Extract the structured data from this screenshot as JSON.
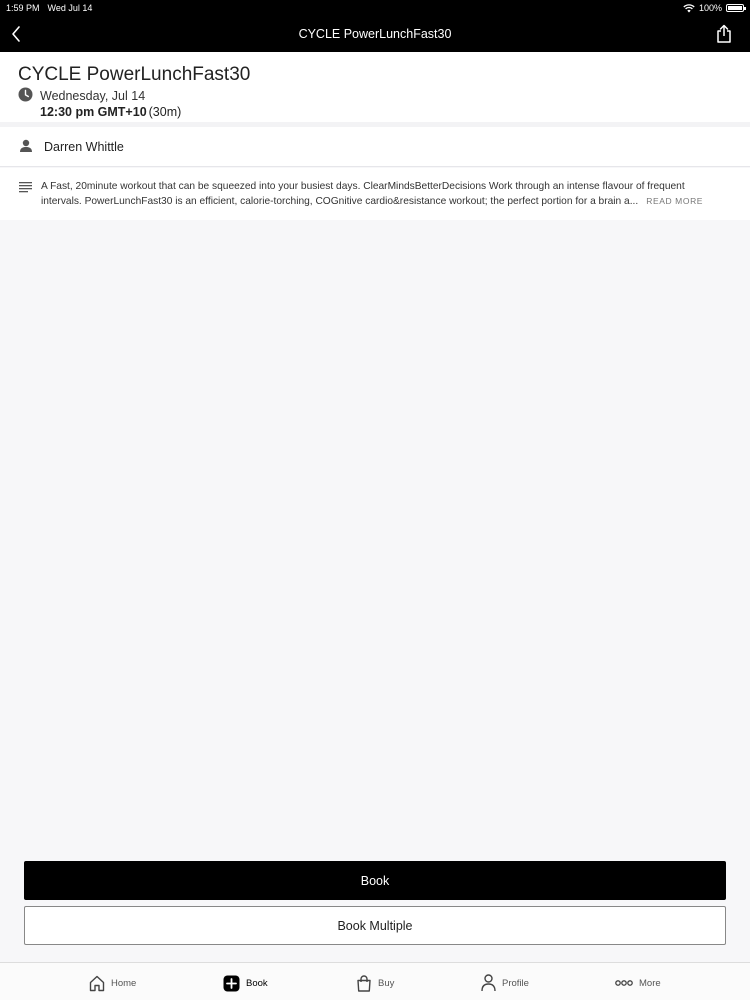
{
  "status_bar": {
    "time": "1:59 PM",
    "date": "Wed Jul 14",
    "battery_pct": "100%",
    "battery_level": 1.0
  },
  "nav": {
    "title": "CYCLE PowerLunchFast30",
    "back_icon": "chevron-left-icon",
    "share_icon": "share-icon"
  },
  "class": {
    "title": "CYCLE PowerLunchFast30",
    "date": "Wednesday, Jul 14",
    "time": "12:30 pm GMT+10",
    "duration": "(30m)",
    "instructor": "Darren Whittle",
    "description_line1": "A Fast, 20minute workout that can be squeezed into your busiest days. ClearMindsBetterDecisions Work through an intense flavour of frequent",
    "description_line2": "intervals. PowerLunchFast30 is an efficient, calorie-torching, COGnitive cardio&resistance workout; the perfect portion for a brain a...",
    "read_more": "READ MORE"
  },
  "actions": {
    "book": "Book",
    "book_multiple": "Book Multiple"
  },
  "tabs": [
    {
      "label": "Home",
      "icon": "home-icon"
    },
    {
      "label": "Book",
      "icon": "book-plus-icon",
      "active": true
    },
    {
      "label": "Buy",
      "icon": "shopping-bag-icon"
    },
    {
      "label": "Profile",
      "icon": "person-icon"
    },
    {
      "label": "More",
      "icon": "more-dots-icon"
    }
  ],
  "colors": {
    "nav_bg": "#000000",
    "primary_button_bg": "#000000",
    "page_bg": "#f7f7f9"
  }
}
